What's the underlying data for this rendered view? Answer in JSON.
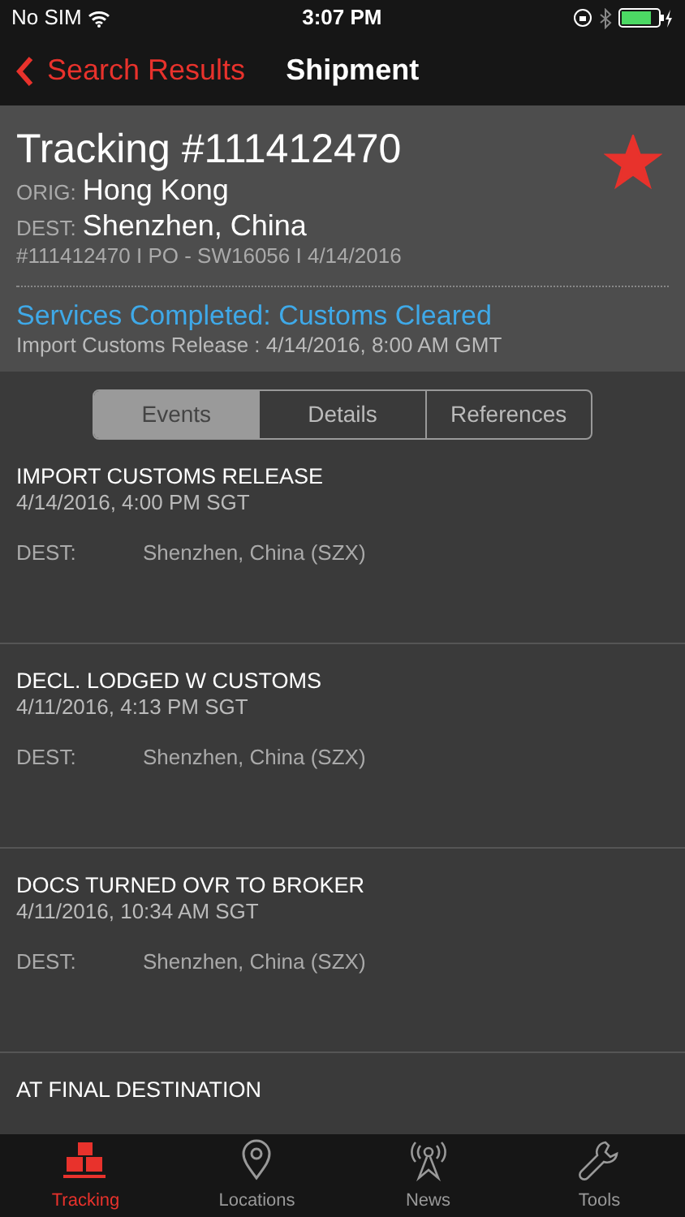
{
  "status_bar": {
    "carrier": "No SIM",
    "time": "3:07 PM"
  },
  "nav": {
    "back": "Search Results",
    "title": "Shipment"
  },
  "shipment": {
    "title": "Tracking #111412470",
    "starred": true,
    "orig_label": "ORIG:",
    "orig": "Hong Kong",
    "dest_label": "DEST:",
    "dest": "Shenzhen, China",
    "reference": "#111412470 I PO - SW16056 I 4/14/2016",
    "status": "Services Completed: Customs Cleared",
    "status_detail": "Import Customs Release : 4/14/2016, 8:00 AM GMT"
  },
  "tabs": [
    {
      "label": "Events",
      "selected": true
    },
    {
      "label": "Details",
      "selected": false
    },
    {
      "label": "References",
      "selected": false
    }
  ],
  "events": [
    {
      "title": "IMPORT CUSTOMS RELEASE",
      "time": "4/14/2016, 4:00 PM SGT",
      "dest_label": "DEST:",
      "dest": "Shenzhen, China (SZX)"
    },
    {
      "title": "DECL. LODGED W CUSTOMS",
      "time": "4/11/2016, 4:13 PM SGT",
      "dest_label": "DEST:",
      "dest": "Shenzhen, China (SZX)"
    },
    {
      "title": "DOCS TURNED OVR TO BROKER",
      "time": "4/11/2016, 10:34 AM SGT",
      "dest_label": "DEST:",
      "dest": "Shenzhen, China (SZX)"
    },
    {
      "title": "AT FINAL DESTINATION"
    }
  ],
  "tab_bar": [
    {
      "kind": "tracking",
      "label": "Tracking",
      "selected": true
    },
    {
      "kind": "location",
      "label": "Locations",
      "selected": false
    },
    {
      "kind": "news",
      "label": "News",
      "selected": false
    },
    {
      "kind": "tools",
      "label": "Tools",
      "selected": false
    }
  ]
}
